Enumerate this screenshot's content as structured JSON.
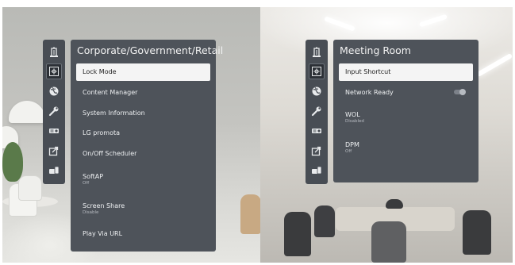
{
  "colors": {
    "panel_bg": "#4e535a",
    "sidebar_bg": "#484d54",
    "selected_bg": "#f4f4f4",
    "text": "#eef0f2",
    "subtext": "#b6bac0"
  },
  "sidebar_icons": [
    {
      "name": "building-icon",
      "active": false
    },
    {
      "name": "display-settings-icon",
      "active": true
    },
    {
      "name": "globe-icon",
      "active": false
    },
    {
      "name": "wrench-icon",
      "active": false
    },
    {
      "name": "projector-icon",
      "active": false
    },
    {
      "name": "share-icon",
      "active": false
    },
    {
      "name": "device-transfer-icon",
      "active": false
    }
  ],
  "left_panel": {
    "title": "Corporate/Government/Retail",
    "items": [
      {
        "label": "Lock Mode",
        "sub": "",
        "selected": true
      },
      {
        "label": "Content Manager",
        "sub": ""
      },
      {
        "label": "System Information",
        "sub": ""
      },
      {
        "label": "LG promota",
        "sub": ""
      },
      {
        "label": "On/Off Scheduler",
        "sub": ""
      },
      {
        "label": "SoftAP",
        "sub": "Off"
      },
      {
        "label": "Screen Share",
        "sub": "Disable"
      },
      {
        "label": "Play Via URL",
        "sub": ""
      }
    ]
  },
  "right_panel": {
    "title": "Meeting Room",
    "items": [
      {
        "label": "Input Shortcut",
        "sub": "",
        "selected": true
      },
      {
        "label": "Network Ready",
        "sub": "",
        "toggle": "off"
      },
      {
        "label": "WOL",
        "sub": "Disabled"
      },
      {
        "label": "DPM",
        "sub": "Off"
      }
    ]
  }
}
